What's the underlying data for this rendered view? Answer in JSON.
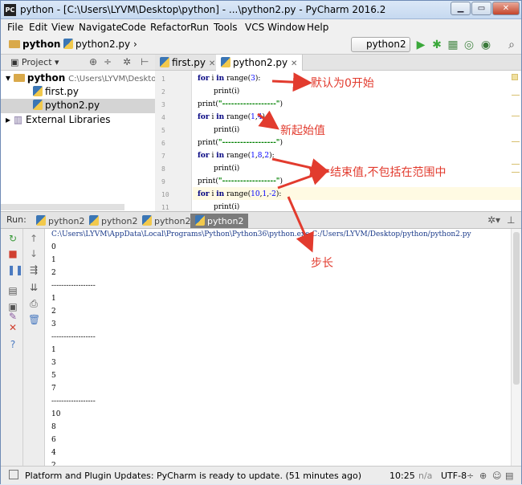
{
  "window": {
    "title": "python - [C:\\Users\\LYVM\\Desktop\\python] - ...\\python2.py - PyCharm 2016.2"
  },
  "menu": [
    "File",
    "Edit",
    "View",
    "Navigate",
    "Code",
    "Refactor",
    "Run",
    "Tools",
    "VCS",
    "Window",
    "Help"
  ],
  "breadcrumb": {
    "folder": "python",
    "file": "python2.py"
  },
  "run_config": "python2",
  "project": {
    "header": "Project",
    "root_name": "python",
    "root_path": "C:\\Users\\LYVM\\Deskto",
    "files": [
      "first.py",
      "python2.py"
    ],
    "external": "External Libraries"
  },
  "editor": {
    "tabs": [
      "first.py",
      "python2.py"
    ],
    "line_numbers": [
      "1",
      "2",
      "3",
      "4",
      "5",
      "6",
      "7",
      "8",
      "9",
      "10",
      "11"
    ]
  },
  "annotations": {
    "a1": "默认为0开始",
    "a2": "新起始值",
    "a3": "结束值,不包括在范围中",
    "a4": "步长"
  },
  "run": {
    "label": "Run:",
    "tabs": [
      "python2",
      "python2",
      "python2",
      "python2"
    ],
    "command": "C:\\Users\\LYVM\\AppData\\Local\\Programs\\Python\\Python36\\python.exe C:/Users/LYVM/Desktop/python/python2.py",
    "output": [
      "0",
      "1",
      "2",
      "------------------",
      "1",
      "2",
      "3",
      "------------------",
      "1",
      "3",
      "5",
      "7",
      "------------------",
      "10",
      "8",
      "6",
      "4",
      "2"
    ]
  },
  "status": {
    "message": "Platform and Plugin Updates: PyCharm is ready to update. (51 minutes ago)",
    "position": "10:25",
    "na": "n/a",
    "encoding": "UTF-8"
  }
}
